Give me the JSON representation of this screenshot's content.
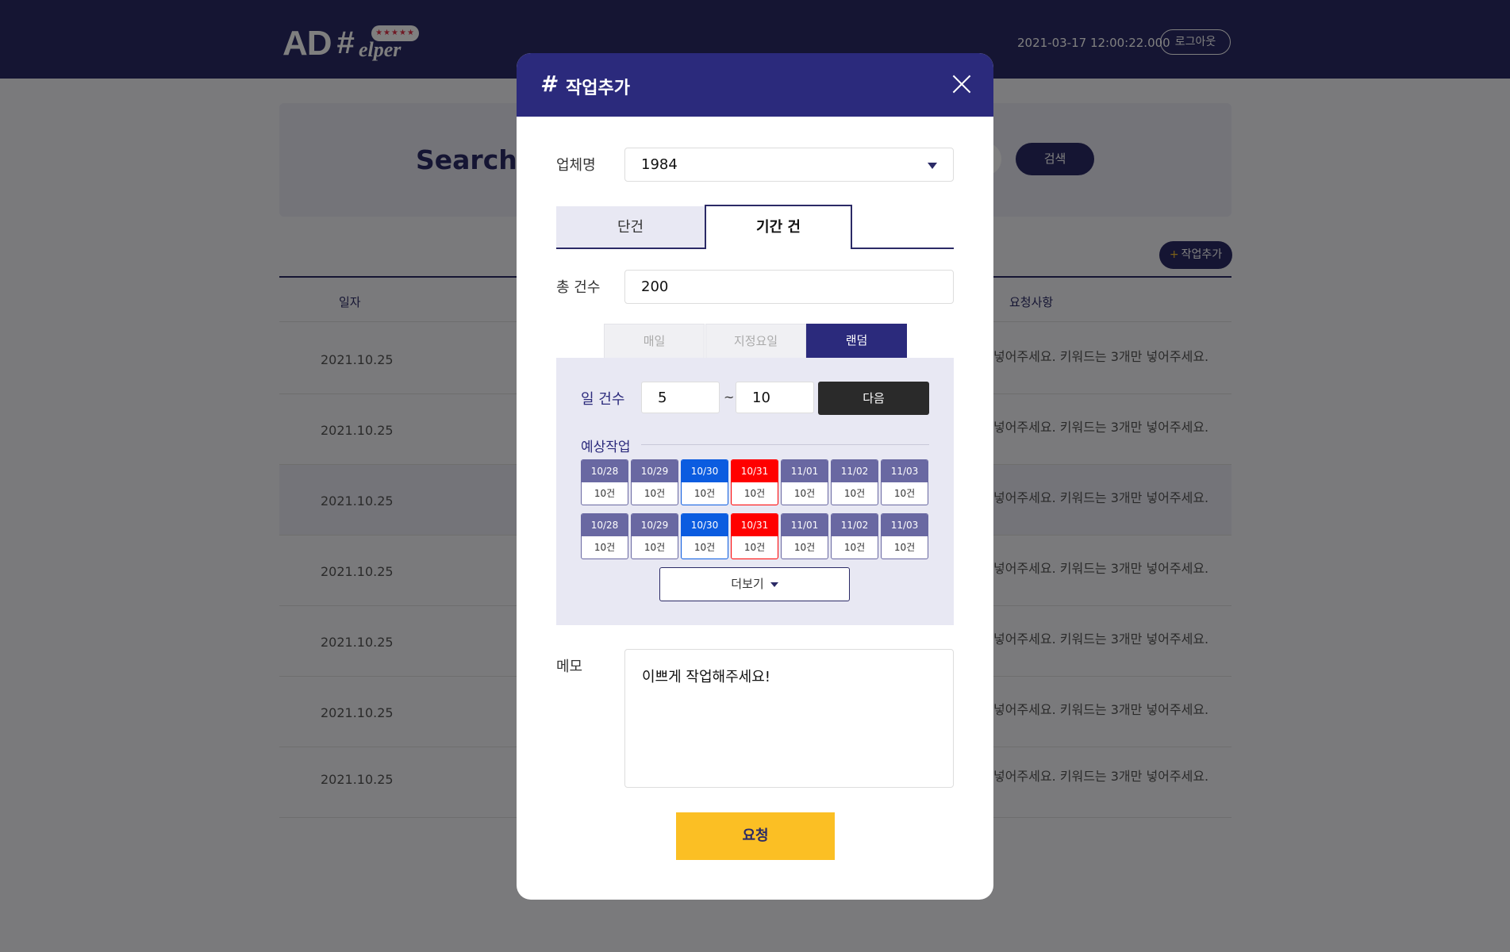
{
  "header": {
    "logo": {
      "ad": "AD",
      "hash": "#",
      "elper": "elper",
      "stars": "★★★★★"
    },
    "datetime": "2021-03-17 12:00:22.000",
    "logout_label": "로그아웃"
  },
  "search": {
    "title": "Search",
    "button_label": "검색"
  },
  "toolbar": {
    "add_task_label": "작업추가"
  },
  "table": {
    "columns": {
      "date": "일자",
      "request": "요청사항"
    },
    "rows": [
      {
        "date": "2021.10.25",
        "request": "넣어주세요. 키워드는 3개만 넣어주세요."
      },
      {
        "date": "2021.10.25",
        "request": "넣어주세요. 키워드는 3개만 넣어주세요."
      },
      {
        "date": "2021.10.25",
        "request": "넣어주세요. 키워드는 3개만 넣어주세요."
      },
      {
        "date": "2021.10.25",
        "request": "넣어주세요. 키워드는 3개만 넣어주세요."
      },
      {
        "date": "2021.10.25",
        "request": "넣어주세요. 키워드는 3개만 넣어주세요."
      },
      {
        "date": "2021.10.25",
        "request": "넣어주세요. 키워드는 3개만 넣어주세요."
      },
      {
        "date": "2021.10.25",
        "request": "넣어주세요. 키워드는 3개만 넣어주세요."
      }
    ]
  },
  "modal": {
    "hash": "#",
    "title": "작업추가",
    "company_label": "업체명",
    "company_value": "1984",
    "tabs": {
      "single": "단건",
      "period": "기간 건"
    },
    "total_label": "총 건수",
    "total_value": "200",
    "schedule_tabs": {
      "daily": "매일",
      "weekday": "지정요일",
      "random": "랜덤"
    },
    "daily_count_label": "일 건수",
    "daily_min": "5",
    "tilde": "~",
    "daily_max": "10",
    "next_label": "다음",
    "expected_label": "예상작업",
    "calendar_rows": [
      [
        {
          "date": "10/28",
          "count": "10건",
          "style": "norm"
        },
        {
          "date": "10/29",
          "count": "10건",
          "style": "norm"
        },
        {
          "date": "10/30",
          "count": "10건",
          "style": "blue"
        },
        {
          "date": "10/31",
          "count": "10건",
          "style": "red"
        },
        {
          "date": "11/01",
          "count": "10건",
          "style": "norm"
        },
        {
          "date": "11/02",
          "count": "10건",
          "style": "norm"
        },
        {
          "date": "11/03",
          "count": "10건",
          "style": "norm"
        }
      ],
      [
        {
          "date": "10/28",
          "count": "10건",
          "style": "norm"
        },
        {
          "date": "10/29",
          "count": "10건",
          "style": "norm"
        },
        {
          "date": "10/30",
          "count": "10건",
          "style": "blue"
        },
        {
          "date": "10/31",
          "count": "10건",
          "style": "red"
        },
        {
          "date": "11/01",
          "count": "10건",
          "style": "norm"
        },
        {
          "date": "11/02",
          "count": "10건",
          "style": "norm"
        },
        {
          "date": "11/03",
          "count": "10건",
          "style": "norm"
        }
      ]
    ],
    "more_label": "더보기",
    "memo_label": "메모",
    "memo_value": "이쁘게 작업해주세요!",
    "submit_label": "요청"
  },
  "colors": {
    "primary": "#2b2a66",
    "modal_header": "#2b2a7c",
    "saturday": "#0b5ce0",
    "sunday": "#ff0000",
    "weekday": "#6968a2",
    "submit": "#fbbf24"
  }
}
